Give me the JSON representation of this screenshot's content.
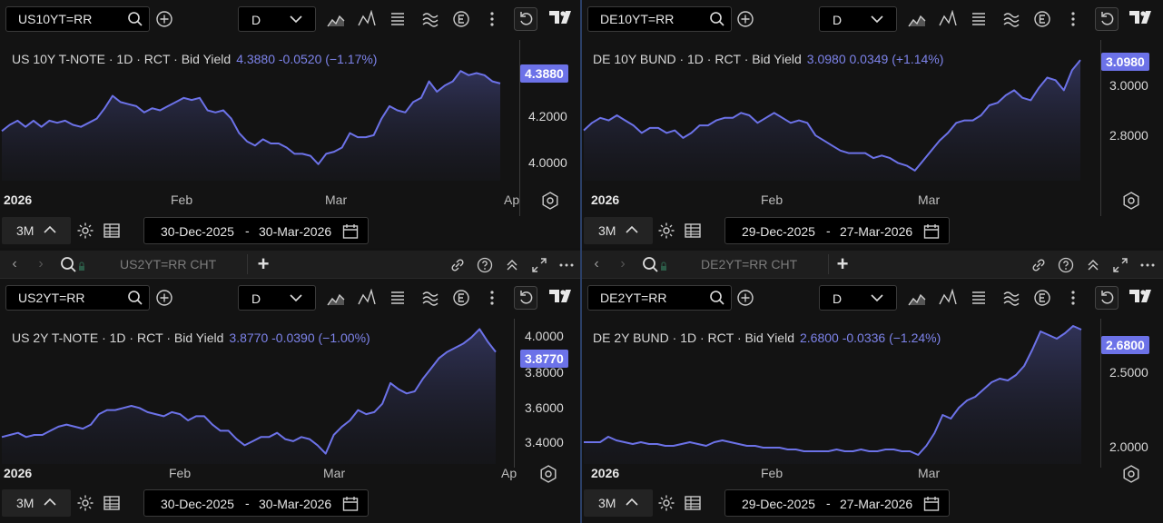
{
  "common": {
    "interval": "D",
    "range_button": "3M",
    "colors": {
      "line": "#6c72e8",
      "badge": "#6c72e8",
      "background": "#131313"
    }
  },
  "panes": {
    "tl": {
      "ric": "US10YT=RR",
      "legend_name": "US 10Y T-NOTE · 1D · RCT · Bid Yield",
      "legend_value": "4.3880  -0.0520 (−1.17%)",
      "last": "4.3880",
      "yticks": [
        "4.2000",
        "4.0000"
      ],
      "xticks": [
        "2026",
        "Feb",
        "Mar",
        "Ap"
      ],
      "date_from": "30-Dec-2025",
      "date_to": "30-Mar-2026",
      "chart_data": {
        "type": "area",
        "ylim": [
          3.92,
          4.6
        ],
        "y": [
          4.16,
          4.19,
          4.21,
          4.18,
          4.21,
          4.18,
          4.21,
          4.2,
          4.21,
          4.19,
          4.18,
          4.2,
          4.22,
          4.27,
          4.33,
          4.3,
          4.29,
          4.28,
          4.25,
          4.27,
          4.26,
          4.28,
          4.3,
          4.32,
          4.31,
          4.32,
          4.26,
          4.25,
          4.26,
          4.22,
          4.15,
          4.11,
          4.09,
          4.12,
          4.1,
          4.1,
          4.08,
          4.05,
          4.05,
          4.04,
          4.0,
          4.05,
          4.06,
          4.08,
          4.15,
          4.13,
          4.13,
          4.14,
          4.22,
          4.28,
          4.26,
          4.25,
          4.3,
          4.32,
          4.4,
          4.35,
          4.38,
          4.4,
          4.45,
          4.43,
          4.44,
          4.43,
          4.4,
          4.39
        ]
      }
    },
    "tr": {
      "ric": "DE10YT=RR",
      "legend_name": "DE 10Y BUND · 1D · RCT · Bid Yield",
      "legend_value": "3.0980  0.0349 (+1.14%)",
      "last": "3.0980",
      "yticks": [
        "3.0000",
        "2.8000"
      ],
      "xticks": [
        "2026",
        "Feb",
        "Mar"
      ],
      "date_from": "29-Dec-2025",
      "date_to": "27-Mar-2026",
      "chart_data": {
        "type": "area",
        "ylim": [
          2.62,
          3.18
        ],
        "y": [
          2.82,
          2.85,
          2.87,
          2.86,
          2.88,
          2.86,
          2.84,
          2.81,
          2.83,
          2.83,
          2.81,
          2.82,
          2.79,
          2.81,
          2.84,
          2.84,
          2.86,
          2.87,
          2.87,
          2.89,
          2.88,
          2.85,
          2.87,
          2.89,
          2.87,
          2.85,
          2.86,
          2.85,
          2.8,
          2.78,
          2.76,
          2.74,
          2.73,
          2.73,
          2.73,
          2.71,
          2.72,
          2.71,
          2.69,
          2.68,
          2.66,
          2.7,
          2.74,
          2.78,
          2.81,
          2.85,
          2.86,
          2.86,
          2.88,
          2.92,
          2.93,
          2.96,
          2.98,
          2.95,
          2.94,
          2.99,
          3.03,
          3.02,
          2.98,
          3.06,
          3.1
        ]
      }
    },
    "bl": {
      "ric": "US2YT=RR",
      "tab_title": "US2YT=RR CHT",
      "legend_name": "US 2Y T-NOTE · 1D · RCT · Bid Yield",
      "legend_value": "3.8770  -0.0390 (−1.00%)",
      "last": "3.8770",
      "yticks": [
        "4.0000",
        "3.8000",
        "3.6000",
        "3.4000"
      ],
      "xticks": [
        "2026",
        "Feb",
        "Mar",
        "Ap"
      ],
      "date_from": "30-Dec-2025",
      "date_to": "30-Mar-2026",
      "chart_data": {
        "type": "area",
        "ylim": [
          3.34,
          4.04
        ],
        "y": [
          3.47,
          3.48,
          3.49,
          3.47,
          3.48,
          3.48,
          3.5,
          3.52,
          3.53,
          3.52,
          3.51,
          3.53,
          3.58,
          3.6,
          3.6,
          3.61,
          3.62,
          3.61,
          3.59,
          3.58,
          3.57,
          3.59,
          3.58,
          3.55,
          3.57,
          3.57,
          3.53,
          3.5,
          3.5,
          3.46,
          3.43,
          3.45,
          3.47,
          3.47,
          3.49,
          3.46,
          3.45,
          3.47,
          3.46,
          3.43,
          3.39,
          3.48,
          3.52,
          3.55,
          3.6,
          3.58,
          3.59,
          3.63,
          3.73,
          3.7,
          3.68,
          3.69,
          3.75,
          3.8,
          3.85,
          3.88,
          3.9,
          3.92,
          3.95,
          3.99,
          3.93,
          3.88
        ]
      }
    },
    "br": {
      "ric": "DE2YT=RR",
      "tab_title": "DE2YT=RR CHT",
      "legend_name": "DE 2Y BUND · 1D · RCT · Bid Yield",
      "legend_value": "2.6800  -0.0336 (−1.24%)",
      "last": "2.6800",
      "yticks": [
        "2.5000",
        "2.0000"
      ],
      "xticks": [
        "2026",
        "Feb",
        "Mar"
      ],
      "date_from": "29-Dec-2025",
      "date_to": "27-Mar-2026",
      "chart_data": {
        "type": "area",
        "ylim": [
          1.95,
          2.75
        ],
        "y": [
          2.07,
          2.07,
          2.07,
          2.1,
          2.08,
          2.07,
          2.06,
          2.07,
          2.06,
          2.06,
          2.05,
          2.05,
          2.06,
          2.07,
          2.06,
          2.05,
          2.07,
          2.08,
          2.07,
          2.06,
          2.05,
          2.05,
          2.04,
          2.04,
          2.04,
          2.03,
          2.03,
          2.02,
          2.02,
          2.02,
          2.02,
          2.03,
          2.02,
          2.02,
          2.03,
          2.02,
          2.02,
          2.03,
          2.03,
          2.02,
          2.02,
          2.0,
          2.05,
          2.12,
          2.22,
          2.2,
          2.26,
          2.3,
          2.32,
          2.36,
          2.4,
          2.42,
          2.41,
          2.44,
          2.49,
          2.58,
          2.68,
          2.66,
          2.64,
          2.67,
          2.71,
          2.69
        ]
      }
    }
  }
}
